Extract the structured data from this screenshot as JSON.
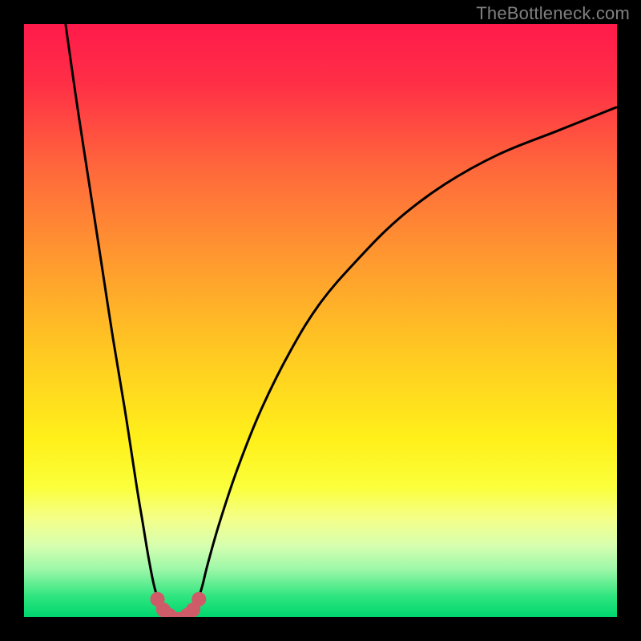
{
  "watermark": {
    "text": "TheBottleneck.com"
  },
  "colors": {
    "black": "#000000",
    "curve": "#000000",
    "marker": "#cf5b69",
    "gradient_stops": [
      {
        "offset": 0.0,
        "color": "#ff1a4b"
      },
      {
        "offset": 0.1,
        "color": "#ff2f46"
      },
      {
        "offset": 0.25,
        "color": "#ff6a3b"
      },
      {
        "offset": 0.4,
        "color": "#ff9a2f"
      },
      {
        "offset": 0.55,
        "color": "#ffc822"
      },
      {
        "offset": 0.7,
        "color": "#fff01a"
      },
      {
        "offset": 0.78,
        "color": "#fbff3a"
      },
      {
        "offset": 0.835,
        "color": "#f4ff8a"
      },
      {
        "offset": 0.88,
        "color": "#d7ffb0"
      },
      {
        "offset": 0.92,
        "color": "#9cf7a8"
      },
      {
        "offset": 0.965,
        "color": "#2fe57f"
      },
      {
        "offset": 1.0,
        "color": "#00d66f"
      }
    ]
  },
  "chart_data": {
    "type": "line",
    "title": "",
    "xlabel": "",
    "ylabel": "",
    "xlim": [
      0,
      100
    ],
    "ylim": [
      0,
      100
    ],
    "series": [
      {
        "name": "left-branch",
        "x": [
          7,
          9,
          11,
          13,
          15,
          17,
          19,
          20,
          21,
          22,
          23,
          24
        ],
        "y": [
          100,
          86,
          73,
          60,
          47,
          35,
          22,
          16,
          10,
          5,
          2,
          0
        ]
      },
      {
        "name": "right-branch",
        "x": [
          28,
          29,
          30,
          31,
          33,
          36,
          40,
          45,
          50,
          56,
          63,
          71,
          80,
          90,
          100
        ],
        "y": [
          0,
          2,
          5,
          9,
          16,
          25,
          35,
          45,
          53,
          60,
          67,
          73,
          78,
          82,
          86
        ]
      },
      {
        "name": "trough",
        "x": [
          23,
          24,
          25,
          26,
          27,
          28,
          29
        ],
        "y": [
          2,
          0,
          0,
          0,
          0,
          0,
          2
        ]
      }
    ],
    "markers": {
      "name": "trough-markers",
      "x": [
        22.5,
        23.5,
        24.5,
        27.5,
        28.5,
        29.5
      ],
      "y": [
        3.0,
        1.2,
        0.3,
        0.3,
        1.2,
        3.0
      ]
    }
  }
}
